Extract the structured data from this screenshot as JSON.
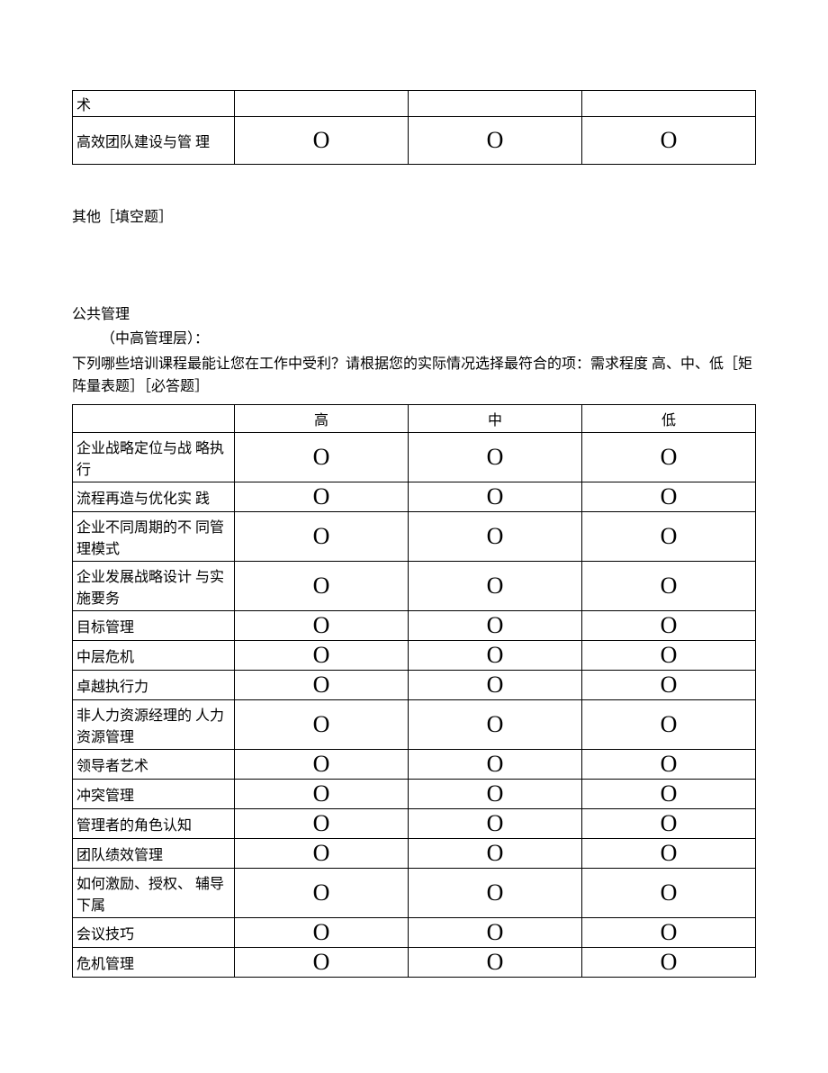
{
  "top_table": {
    "rows": [
      {
        "label": "术",
        "o1": "",
        "o2": "",
        "o3": ""
      },
      {
        "label": "高效团队建设与管 理",
        "o1": "O",
        "o2": "O",
        "o3": "O"
      }
    ]
  },
  "other_label": "其他［填空题］",
  "section_title": "公共管理",
  "subtitle": "（中高管理层）：",
  "question_text": "下列哪些培训课程最能让您在工作中受利？请根据您的实际情况选择最符合的项：需求程度 高、中、低［矩阵量表题］［必答题］",
  "matrix": {
    "headers": [
      "",
      "高",
      "中",
      "低"
    ],
    "rows": [
      {
        "label": "企业战略定位与战 略执行"
      },
      {
        "label": "流程再造与优化实 践"
      },
      {
        "label": "企业不同周期的不 同管理模式"
      },
      {
        "label": "企业发展战略设计 与实施要务"
      },
      {
        "label": "目标管理"
      },
      {
        "label": "中层危机"
      },
      {
        "label": "卓越执行力"
      },
      {
        "label": "非人力资源经理的 人力资源管理"
      },
      {
        "label": "领导者艺术"
      },
      {
        "label": "冲突管理"
      },
      {
        "label": "管理者的角色认知"
      },
      {
        "label": "团队绩效管理"
      },
      {
        "label": "如何激励、授权、 辅导下属"
      },
      {
        "label": "会议技巧"
      },
      {
        "label": "危机管理"
      }
    ],
    "option_glyph": "O"
  }
}
